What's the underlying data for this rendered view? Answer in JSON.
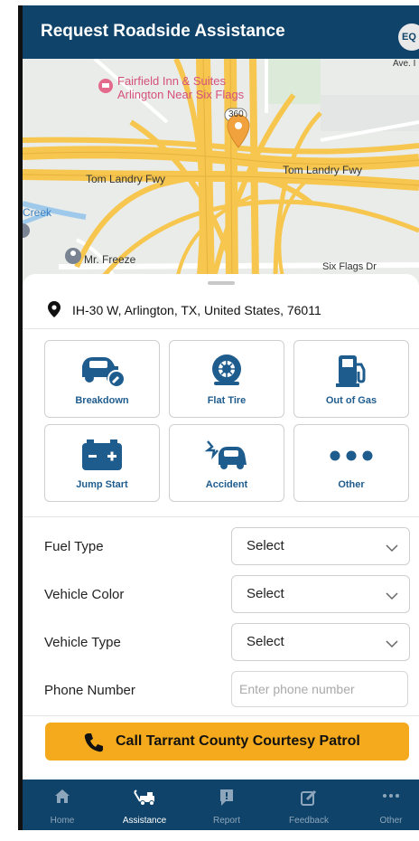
{
  "header": {
    "title": "Request Roadside Assistance",
    "avatar_initials": "EQ"
  },
  "map": {
    "labels": {
      "hotel_line1": "Fairfield Inn & Suites",
      "hotel_line2": "Arlington Near Six Flags",
      "route": "360",
      "freeway_left": "Tom Landry Fwy",
      "freeway_right": "Tom Landry Fwy",
      "creek": "Creek",
      "freeze": "Mr. Freeze",
      "six_flags_dr": "Six Flags Dr",
      "ave": "Ave. I"
    },
    "colors": {
      "road": "#f6c64f",
      "land": "#e7ebe8",
      "water": "#9fc9ea"
    }
  },
  "location": {
    "address": "IH-30 W, Arlington, TX, United States, 76011"
  },
  "services": [
    {
      "label": "Breakdown",
      "icon": "car-wrench-icon"
    },
    {
      "label": "Flat Tire",
      "icon": "tire-icon"
    },
    {
      "label": "Out of Gas",
      "icon": "fuel-pump-icon"
    },
    {
      "label": "Jump Start",
      "icon": "battery-icon"
    },
    {
      "label": "Accident",
      "icon": "car-crash-icon"
    },
    {
      "label": "Other",
      "icon": "more-dots-icon"
    }
  ],
  "form": {
    "fuel_type": {
      "label": "Fuel Type",
      "value": "Select"
    },
    "vehicle_color": {
      "label": "Vehicle Color",
      "value": "Select"
    },
    "vehicle_type": {
      "label": "Vehicle Type",
      "value": "Select"
    },
    "phone": {
      "label": "Phone Number",
      "placeholder": "Enter phone number"
    }
  },
  "call_button": {
    "label": "Call Tarrant County Courtesy Patrol"
  },
  "nav": {
    "items": [
      {
        "label": "Home",
        "icon": "home-icon"
      },
      {
        "label": "Assistance",
        "icon": "tow-truck-icon",
        "active": true
      },
      {
        "label": "Report",
        "icon": "report-icon"
      },
      {
        "label": "Feedback",
        "icon": "edit-icon"
      },
      {
        "label": "Other",
        "icon": "more-icon"
      }
    ]
  },
  "colors": {
    "primary": "#0f4369",
    "accent": "#f4aa1c",
    "icon_blue": "#1f5c8e"
  }
}
